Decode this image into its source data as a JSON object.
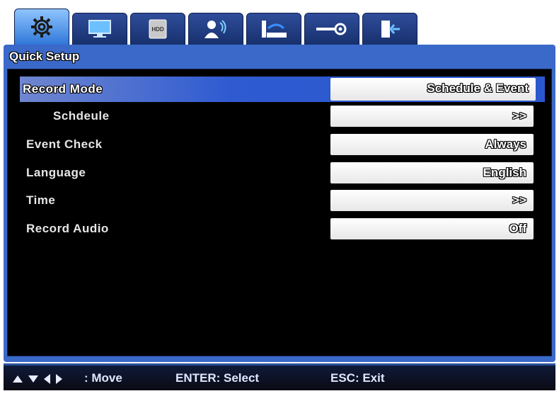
{
  "tabs": [
    {
      "icon": "gear-icon",
      "active": true
    },
    {
      "icon": "monitor-icon",
      "active": false
    },
    {
      "icon": "hdd-icon",
      "active": false,
      "label": "HDD"
    },
    {
      "icon": "user-network-icon",
      "active": false
    },
    {
      "icon": "network-icon",
      "active": false
    },
    {
      "icon": "system-settings-icon",
      "active": false
    },
    {
      "icon": "exit-icon",
      "active": false
    }
  ],
  "window": {
    "title": "Quick Setup"
  },
  "rows": [
    {
      "label": "Record Mode",
      "value": "Schedule & Event",
      "selected": true
    },
    {
      "label": "Schdeule",
      "value": ">>",
      "indent": true
    },
    {
      "label": "Event Check",
      "value": "Always"
    },
    {
      "label": "Language",
      "value": "English"
    },
    {
      "label": "Time",
      "value": ">>"
    },
    {
      "label": "Record Audio",
      "value": "Off"
    }
  ],
  "helpbar": {
    "move": ": Move",
    "enter": "ENTER: Select",
    "esc": "ESC: Exit"
  },
  "colors": {
    "window_blue": "#3b69c9",
    "selection_blue": "#2a56cf",
    "panel_black": "#000000"
  }
}
